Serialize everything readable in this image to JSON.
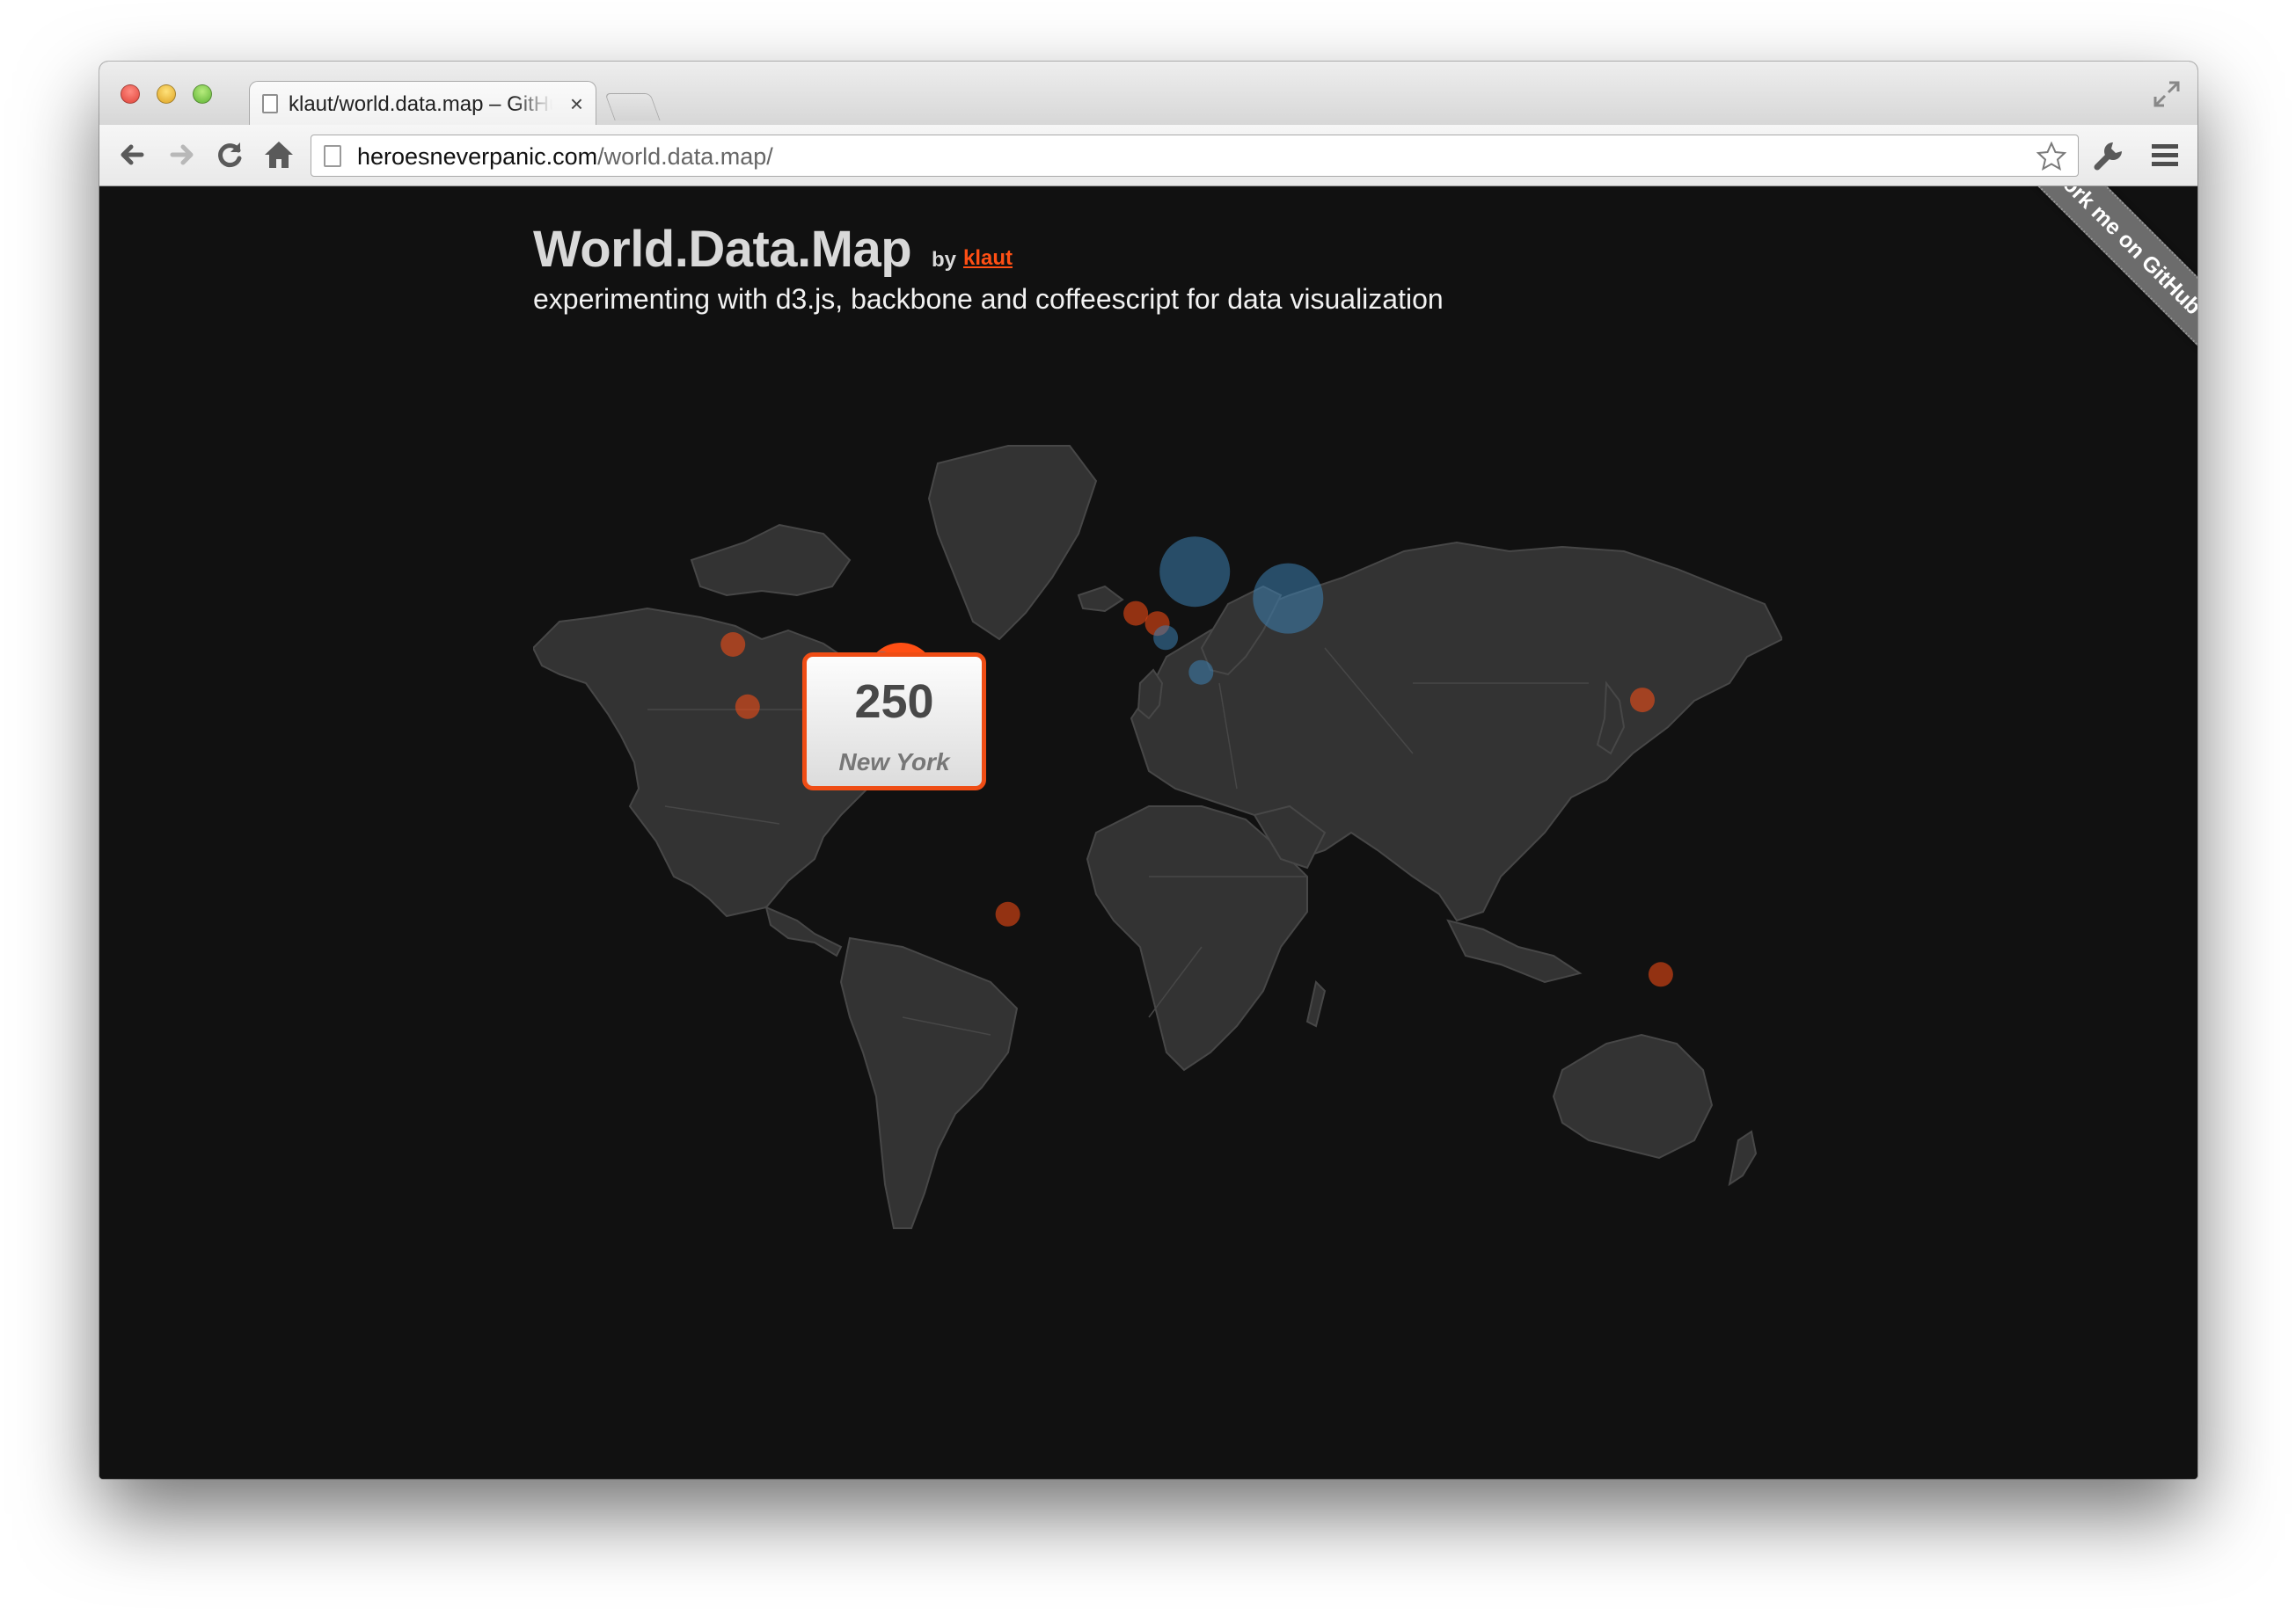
{
  "browser": {
    "tab_title": "klaut/world.data.map – GitHub",
    "tab_close_glyph": "×",
    "url_host": "heroesneverpanic.com",
    "url_path": "/world.data.map/",
    "icons": [
      "back-icon",
      "forward-icon",
      "reload-icon",
      "home-icon",
      "bookmark-star-icon",
      "wrench-icon",
      "menu-icon",
      "fullscreen-icon",
      "file-icon"
    ]
  },
  "page": {
    "title": "World.Data.Map",
    "by": "by",
    "author": "klaut",
    "subtitle": "experimenting with d3.js, backbone and coffeescript for data visualization",
    "ribbon": "Fork me on GitHub"
  },
  "tooltip": {
    "value": "250",
    "label": "New York"
  },
  "colors": {
    "background": "#111111",
    "land": "#333333",
    "borders": "#474747",
    "accent_orange": "#ff4f14",
    "accent_blue": "#3d7fb0"
  },
  "chart_data": {
    "type": "scatter",
    "points": [
      {
        "lon": -74.0,
        "lat": 40.7,
        "color": "orange",
        "highlight": true,
        "value": 250,
        "label": "New York"
      },
      {
        "lon": -118.2,
        "lat": 34.1,
        "color": "orange"
      },
      {
        "lon": -122.4,
        "lat": 47.6,
        "color": "orange"
      },
      {
        "lon": -79.4,
        "lat": 43.7,
        "color": "blue"
      },
      {
        "lon": -43.2,
        "lat": -22.9,
        "color": "orange"
      },
      {
        "lon": -0.1,
        "lat": 51.5,
        "color": "orange"
      },
      {
        "lon": -6.3,
        "lat": 53.3,
        "color": "orange"
      },
      {
        "lon": 2.3,
        "lat": 48.9,
        "color": "blue"
      },
      {
        "lon": 10.7,
        "lat": 59.9,
        "color": "blue"
      },
      {
        "lon": 12.5,
        "lat": 41.9,
        "color": "blue"
      },
      {
        "lon": 37.6,
        "lat": 55.8,
        "color": "blue"
      },
      {
        "lon": 139.7,
        "lat": 35.7,
        "color": "orange"
      },
      {
        "lon": 145.0,
        "lat": -37.8,
        "color": "orange"
      }
    ]
  }
}
